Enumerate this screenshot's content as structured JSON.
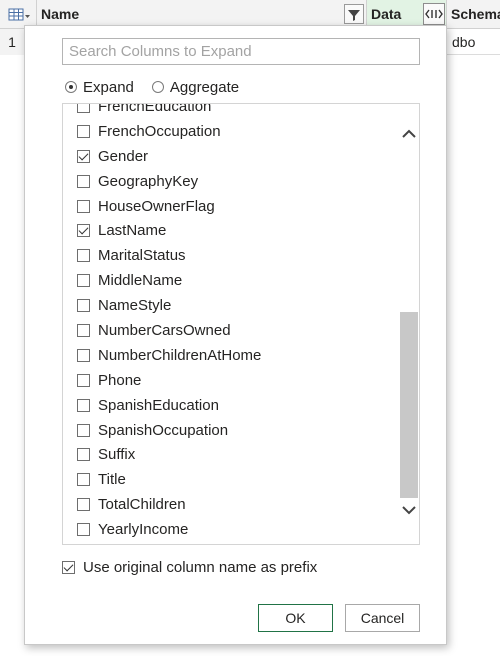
{
  "grid": {
    "columns": [
      "Name",
      "Data",
      "Schema"
    ],
    "rows": [
      {
        "index": "1",
        "schema": "dbo"
      }
    ]
  },
  "dialog": {
    "search_placeholder": "Search Columns to Expand",
    "mode_options": [
      {
        "label": "Expand",
        "selected": true
      },
      {
        "label": "Aggregate",
        "selected": false
      }
    ],
    "columns_list": [
      {
        "label": "FrenchEducation",
        "checked": false
      },
      {
        "label": "FrenchOccupation",
        "checked": false
      },
      {
        "label": "Gender",
        "checked": true
      },
      {
        "label": "GeographyKey",
        "checked": false
      },
      {
        "label": "HouseOwnerFlag",
        "checked": false
      },
      {
        "label": "LastName",
        "checked": true
      },
      {
        "label": "MaritalStatus",
        "checked": false
      },
      {
        "label": "MiddleName",
        "checked": false
      },
      {
        "label": "NameStyle",
        "checked": false
      },
      {
        "label": "NumberCarsOwned",
        "checked": false
      },
      {
        "label": "NumberChildrenAtHome",
        "checked": false
      },
      {
        "label": "Phone",
        "checked": false
      },
      {
        "label": "SpanishEducation",
        "checked": false
      },
      {
        "label": "SpanishOccupation",
        "checked": false
      },
      {
        "label": "Suffix",
        "checked": false
      },
      {
        "label": "Title",
        "checked": false
      },
      {
        "label": "TotalChildren",
        "checked": false
      },
      {
        "label": "YearlyIncome",
        "checked": false
      }
    ],
    "prefix_option": {
      "label": "Use original column name as prefix",
      "checked": true
    },
    "ok_label": "OK",
    "cancel_label": "Cancel"
  },
  "icons": {
    "table": "table-menu-icon",
    "filter": "filter-icon",
    "expand": "expand-columns-icon",
    "scroll_up": "chevron-up-icon",
    "scroll_down": "chevron-down-icon"
  },
  "colors": {
    "accent_green": "#217346",
    "data_header_bg": "#e2f3e4"
  }
}
